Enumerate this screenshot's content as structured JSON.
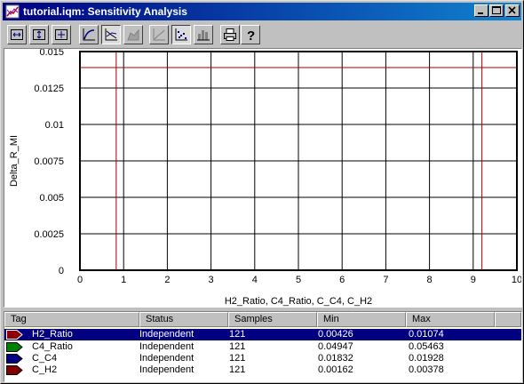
{
  "window": {
    "title": "tutorial.iqm: Sensitivity Analysis",
    "controls": [
      "minimize",
      "maximize",
      "close"
    ]
  },
  "toolbar": {
    "buttons": [
      {
        "name": "zoom-fit-both-icon",
        "pressed": false
      },
      {
        "name": "zoom-fit-vertical-icon",
        "pressed": false
      },
      {
        "name": "zoom-fit-all-icon",
        "pressed": false
      },
      {
        "name": "line-curve-icon",
        "pressed": false
      },
      {
        "name": "line-plot-icon",
        "pressed": true
      },
      {
        "name": "area-plot-icon",
        "pressed": false
      },
      {
        "name": "step-plot-icon",
        "pressed": false
      },
      {
        "name": "scatter-plot-icon",
        "pressed": true
      },
      {
        "name": "bar-chart-icon",
        "pressed": false
      },
      {
        "name": "print-icon",
        "pressed": false
      },
      {
        "name": "help-icon",
        "pressed": false
      }
    ]
  },
  "chart_data": {
    "type": "scatter",
    "title": "",
    "xlabel": "H2_Ratio, C4_Ratio, C_C4, C_H2",
    "ylabel": "Delta_R_MI",
    "xlim": [
      0,
      10
    ],
    "ylim": [
      0,
      0.015
    ],
    "x_ticks": [
      "0",
      "1",
      "2",
      "3",
      "4",
      "5",
      "6",
      "7",
      "8",
      "9",
      "10"
    ],
    "y_ticks": [
      "0",
      "0.0025",
      "0.005",
      "0.0075",
      "0.01",
      "0.0125",
      "0.015"
    ],
    "grid": true,
    "cursor_lines": {
      "x": [
        0.83,
        9.2
      ],
      "y": [
        0.0139
      ],
      "color": "#a00000"
    },
    "series": []
  },
  "table": {
    "columns": [
      "Tag",
      "Status",
      "Samples",
      "Min",
      "Max"
    ],
    "rows": [
      {
        "tag": "H2_Ratio",
        "status": "Independent",
        "samples": "121",
        "min": "0.00426",
        "max": "0.01074",
        "color": "#8b0000",
        "selected": true
      },
      {
        "tag": "C4_Ratio",
        "status": "Independent",
        "samples": "121",
        "min": "0.04947",
        "max": "0.05463",
        "color": "#008000",
        "selected": false
      },
      {
        "tag": "C_C4",
        "status": "Independent",
        "samples": "121",
        "min": "0.01832",
        "max": "0.01928",
        "color": "#000080",
        "selected": false
      },
      {
        "tag": "C_H2",
        "status": "Independent",
        "samples": "121",
        "min": "0.00162",
        "max": "0.00378",
        "color": "#800000",
        "selected": false
      }
    ]
  }
}
